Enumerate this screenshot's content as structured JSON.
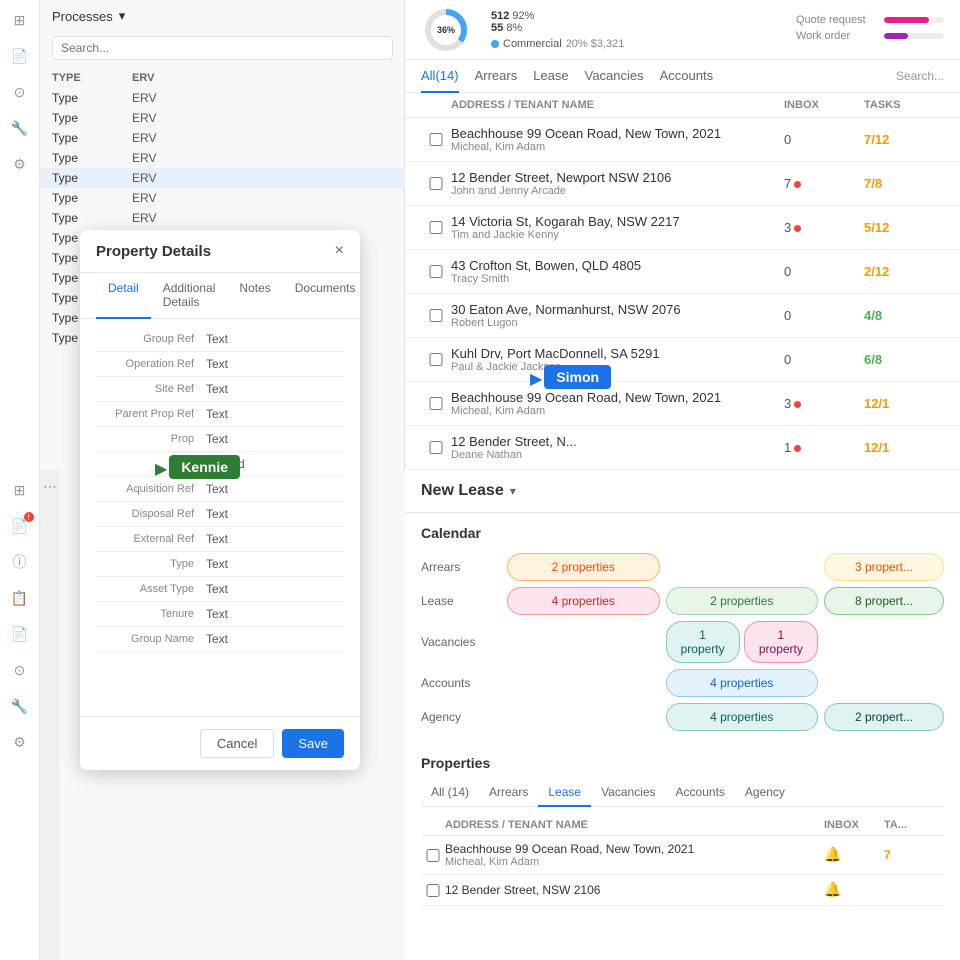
{
  "sidebar": {
    "processes_label": "Processes",
    "list_header": {
      "type": "TYPE",
      "erv": "ERV"
    },
    "rows": [
      {
        "type": "Type",
        "erv": "ERV"
      },
      {
        "type": "Type",
        "erv": "ERV"
      },
      {
        "type": "Type",
        "erv": "ERV"
      },
      {
        "type": "Type",
        "erv": "ERV"
      },
      {
        "type": "Type",
        "erv": "ERV",
        "selected": true
      },
      {
        "type": "Type",
        "erv": "ERV"
      },
      {
        "type": "Type",
        "erv": "ERV"
      },
      {
        "type": "Type",
        "erv": "ERV"
      },
      {
        "type": "Type",
        "erv": "ERV"
      },
      {
        "type": "Type",
        "erv": "ERV"
      },
      {
        "type": "Type",
        "erv": "ERV"
      },
      {
        "type": "Type",
        "erv": "ERV"
      },
      {
        "type": "Type",
        "erv": "ERV"
      }
    ]
  },
  "stats": {
    "donut_percent": "36%",
    "num1": "512",
    "pct1": "92%",
    "num2": "55",
    "pct2": "8%",
    "commercial_label": "Commercial",
    "commercial_val": "20% $3,321",
    "quote_request_label": "Quote request",
    "work_order_label": "Work order"
  },
  "tabs_top": {
    "all": "All(14)",
    "arrears": "Arrears",
    "lease": "Lease",
    "vacancies": "Vacancies",
    "accounts": "Accounts",
    "search_placeholder": "Search..."
  },
  "table_header": {
    "address": "ADDRESS / TENANT NAME",
    "inbox": "INBOX",
    "tasks": "TASKS"
  },
  "rows_top": [
    {
      "address": "Beachhouse 99 Ocean Road, New Town, 2021",
      "tenant": "Micheal, Kim Adam",
      "inbox": "0",
      "tasks": "7/12",
      "tasks_color": "orange"
    },
    {
      "address": "12 Bender Street, Newport NSW 2106",
      "tenant": "John and Jenny Arcade",
      "inbox": "7",
      "tasks": "7/8",
      "tasks_color": "orange",
      "dot": true
    },
    {
      "address": "14 Victoria St, Kogarah Bay, NSW 2217",
      "tenant": "Tim and Jackie Kenny",
      "inbox": "3",
      "tasks": "5/12",
      "tasks_color": "orange",
      "dot": true
    },
    {
      "address": "43 Crofton St, Bowen, QLD 4805",
      "tenant": "Tracy Smith",
      "inbox": "0",
      "tasks": "2/12",
      "tasks_color": "orange"
    },
    {
      "address": "30 Eaton Ave, Normanhurst, NSW 2076",
      "tenant": "Robert Lugon",
      "inbox": "0",
      "tasks": "4/8",
      "tasks_color": "green"
    },
    {
      "address": "Kuhl Drv, Port MacDonnell, SA 5291",
      "tenant": "Paul & Jackie Jackson",
      "inbox": "0",
      "tasks": "6/8",
      "tasks_color": "green"
    },
    {
      "address": "Beachhouse 99 Ocean Road, New Town, 2021",
      "tenant": "Micheal, Kim Adam",
      "inbox": "3",
      "tasks": "12/1",
      "tasks_color": "orange",
      "dot": true
    },
    {
      "address": "12 Bender Street, N...",
      "tenant": "Deane Nathan",
      "inbox": "1",
      "tasks": "12/1",
      "tasks_color": "orange",
      "dot": true
    }
  ],
  "modal": {
    "title": "Property Details",
    "close": "×",
    "tabs": [
      "Detail",
      "Additional Details",
      "Notes",
      "Documents"
    ],
    "active_tab": "Detail",
    "fields": [
      {
        "label": "Group Ref",
        "value": "Text"
      },
      {
        "label": "Operation Ref",
        "value": "Text"
      },
      {
        "label": "Site Ref",
        "value": "Text"
      },
      {
        "label": "Parent Prop Ref",
        "value": "Text"
      },
      {
        "label": "Prop",
        "value": "Text"
      },
      {
        "label": "",
        "value": "Shared"
      },
      {
        "label": "Aquisition Ref",
        "value": "Text"
      },
      {
        "label": "Disposal Ref",
        "value": "Text"
      },
      {
        "label": "External Ref",
        "value": "Text"
      },
      {
        "label": "Type",
        "value": "Text"
      },
      {
        "label": "Asset Type",
        "value": "Text"
      },
      {
        "label": "Tenure",
        "value": "Text"
      },
      {
        "label": "Group Name",
        "value": "Text"
      }
    ],
    "cancel_label": "Cancel",
    "save_label": "Save"
  },
  "cursors": {
    "kennie": "Kennie",
    "simon": "Simon"
  },
  "new_lease": {
    "title": "New Lease",
    "calendar_title": "Calendar",
    "rows": [
      {
        "label": "Arrears",
        "left": "2 properties",
        "left_class": "chip-orange",
        "right": "3 propert...",
        "right_class": "chip-right2"
      },
      {
        "label": "Lease",
        "left": "4 properties",
        "left_class": "chip-red",
        "mid": "2 properties",
        "mid_class": "chip-green",
        "right": "8 propert...",
        "right_class": "chip-right"
      },
      {
        "label": "Vacancies",
        "left": "",
        "mid": "1 property",
        "mid_class": "chip-teal",
        "mid2": "1 property",
        "mid2_class": "chip-pink"
      },
      {
        "label": "Accounts",
        "mid_full": "4 properties",
        "mid_full_class": "chip-blue-outline"
      },
      {
        "label": "Agency",
        "mid_full": "4 properties",
        "mid_full_class": "chip-teal",
        "right": "2 propert...",
        "right_class": "chip-right5"
      }
    ]
  },
  "properties": {
    "title": "Properties",
    "tabs": [
      "All (14)",
      "Arrears",
      "Lease",
      "Vacancies",
      "Accounts",
      "Agency"
    ],
    "active_tab": "Lease",
    "header": {
      "address": "Address / Tenant Name",
      "inbox": "Inbox",
      "tasks": "Ta..."
    },
    "rows": [
      {
        "address": "Beachhouse 99 Ocean Road, New Town, 2021",
        "tenant": "Micheal, Kim Adam",
        "has_icon": true
      },
      {
        "address": "12 Bender Street, NSW 2106",
        "tenant": "",
        "has_icon": true
      }
    ]
  }
}
